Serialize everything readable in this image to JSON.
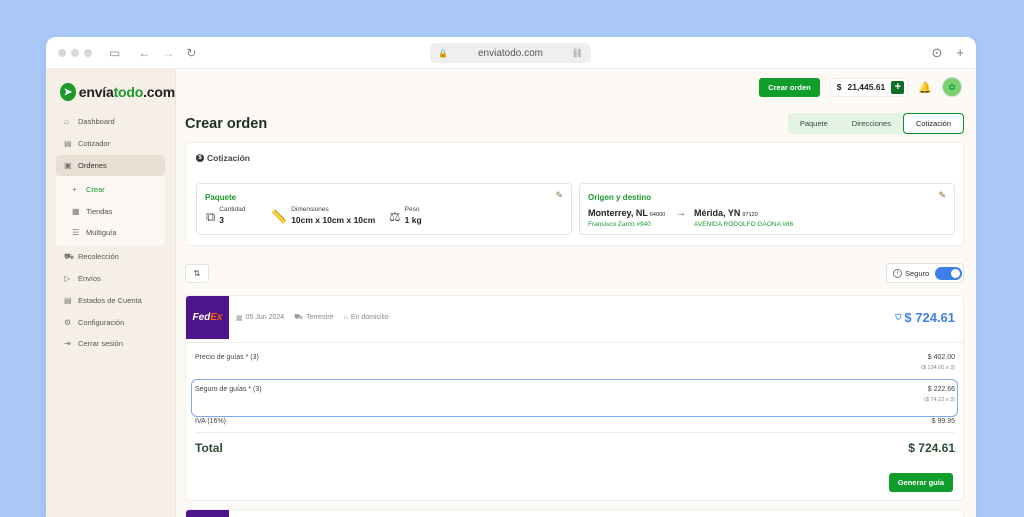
{
  "browser": {
    "url": "enviatodo.com"
  },
  "brand": {
    "name_part1": "envía",
    "name_part2": "todo",
    "name_part3": ".com"
  },
  "sidebar": {
    "items": [
      {
        "label": "Dashboard",
        "icon": "home-icon"
      },
      {
        "label": "Cotizador",
        "icon": "document-icon"
      },
      {
        "label": "Ordenes",
        "icon": "box-icon"
      },
      {
        "label": "Crear",
        "icon": "plus-icon"
      },
      {
        "label": "Tiendas",
        "icon": "store-icon"
      },
      {
        "label": "Multiguía",
        "icon": "list-icon"
      },
      {
        "label": "Recolección",
        "icon": "truck-icon"
      },
      {
        "label": "Envíos",
        "icon": "send-icon"
      },
      {
        "label": "Estados de Cuenta",
        "icon": "statement-icon"
      },
      {
        "label": "Configuración",
        "icon": "gear-icon"
      },
      {
        "label": "Cerrar sesión",
        "icon": "logout-icon"
      }
    ]
  },
  "header": {
    "create_order_label": "Crear orden",
    "currency": "$",
    "balance": "21,445.61"
  },
  "page": {
    "title": "Crear orden",
    "tabs": [
      "Paquete",
      "Direcciones",
      "Cotización"
    ],
    "selected_tab": "Cotización"
  },
  "quote": {
    "heading": "Cotización",
    "package": {
      "title": "Paquete",
      "cantidad_label": "Cantidad",
      "cantidad": "3",
      "dimensiones_label": "Dimensiones",
      "dimensiones": "10cm x 10cm x 10cm",
      "peso_label": "Peso",
      "peso": "1 kg"
    },
    "route": {
      "title": "Origen y destino",
      "origin_city": "Monterrey, NL",
      "origin_zip": "64000",
      "origin_street": "Fransisco Zarco #940",
      "dest_city": "Mérida, YN",
      "dest_zip": "97120",
      "dest_street": "AVENIDA RODOLFO GAONA #86"
    }
  },
  "seguro_label": "Seguro",
  "result": {
    "carrier_fed": "Fed",
    "carrier_ex": "Ex",
    "date": "05 Jun 2024",
    "service": "Terrestre",
    "delivery": "En domicilio",
    "price": "$ 724.61",
    "rows": {
      "guias_label": "Precio de guías * (3)",
      "guias_value": "$ 402.00",
      "guias_detail": "($ 134.00 x 3)",
      "seguro_label": "Seguro de guías * (3)",
      "seguro_value": "$ 222.66",
      "seguro_detail": "($ 74.22 x 3)",
      "iva_label": "IVA (16%)",
      "iva_value": "$ 99.95"
    },
    "total_label": "Total",
    "total_value": "$ 724.61",
    "generate_label": "Generar guía"
  }
}
